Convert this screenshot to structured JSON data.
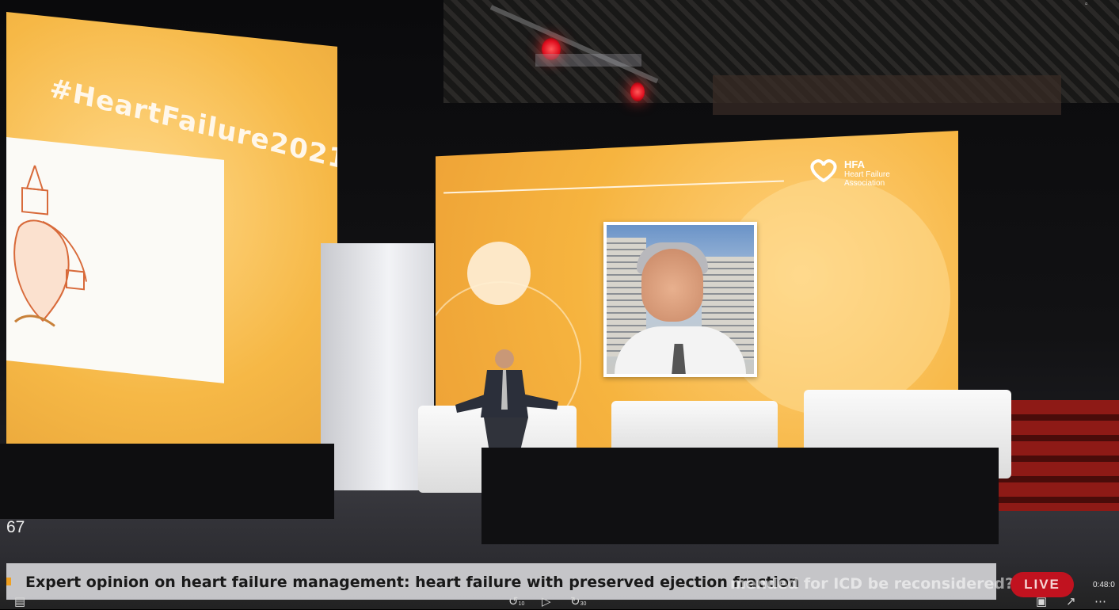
{
  "stage_screen_left": {
    "hashtag": "#HeartFailure2021"
  },
  "stage_screen_right": {
    "logo": {
      "acronym": "HFA",
      "name_line1": "Heart Failure",
      "name_line2": "Association"
    }
  },
  "overlay": {
    "viewer_count": "67",
    "lower_third_title": "Expert opinion on heart failure management: heart failure with preserved ejection fraction",
    "lower_third_ghost": "mended for ICD be reconsidered?",
    "live_label": "LIVE",
    "time": "0:48:0"
  },
  "player_controls": {
    "captions_icon": "captions-icon",
    "rewind_label": "10",
    "forward_label": "30",
    "play_icon": "play-icon",
    "pip_icon": "picture-in-picture-icon",
    "fullscreen_icon": "fullscreen-icon",
    "more_icon": "more-icon"
  },
  "colors": {
    "live": "#c1121f",
    "screen_orange": "#f6b846",
    "lower_third_bg": "#d2d2d6"
  }
}
